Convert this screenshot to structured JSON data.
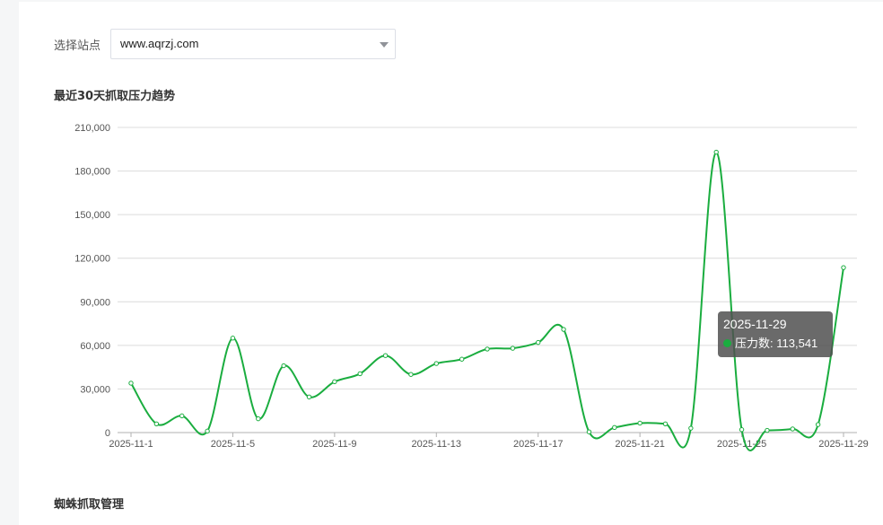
{
  "filter": {
    "label": "选择站点",
    "selected_site": "www.aqrzj.com"
  },
  "chart_title": "最近30天抓取压力趋势",
  "section_title": "蜘蛛抓取管理",
  "tooltip": {
    "date": "2025-11-29",
    "series_label": "压力数",
    "value_text": "113,541"
  },
  "colors": {
    "line": "#1aad3f",
    "grid": "#dcdcdc"
  },
  "chart_data": {
    "type": "line",
    "x": [
      "2025-11-1",
      "2025-11-2",
      "2025-11-3",
      "2025-11-4",
      "2025-11-5",
      "2025-11-6",
      "2025-11-7",
      "2025-11-8",
      "2025-11-9",
      "2025-11-10",
      "2025-11-11",
      "2025-11-12",
      "2025-11-13",
      "2025-11-14",
      "2025-11-15",
      "2025-11-16",
      "2025-11-17",
      "2025-11-18",
      "2025-11-19",
      "2025-11-20",
      "2025-11-21",
      "2025-11-22",
      "2025-11-23",
      "2025-11-24",
      "2025-11-25",
      "2025-11-26",
      "2025-11-27",
      "2025-11-28",
      "2025-11-29"
    ],
    "x_tick_labels": [
      "2025-11-1",
      "2025-11-5",
      "2025-11-9",
      "2025-11-13",
      "2025-11-17",
      "2025-11-21",
      "2025-11-25",
      "2025-11-29"
    ],
    "y_tick_labels": [
      "0",
      "30,000",
      "60,000",
      "90,000",
      "120,000",
      "150,000",
      "180,000",
      "210,000"
    ],
    "ylim": [
      0,
      210000
    ],
    "grid": true,
    "series": [
      {
        "name": "压力数",
        "values": [
          34000,
          6000,
          11500,
          1000,
          65000,
          9500,
          46000,
          24500,
          35000,
          40500,
          53000,
          40000,
          47500,
          50500,
          57500,
          58000,
          62000,
          71000,
          500,
          3500,
          6500,
          6000,
          3000,
          193000,
          2000,
          1500,
          2500,
          5500,
          113541
        ]
      }
    ]
  }
}
